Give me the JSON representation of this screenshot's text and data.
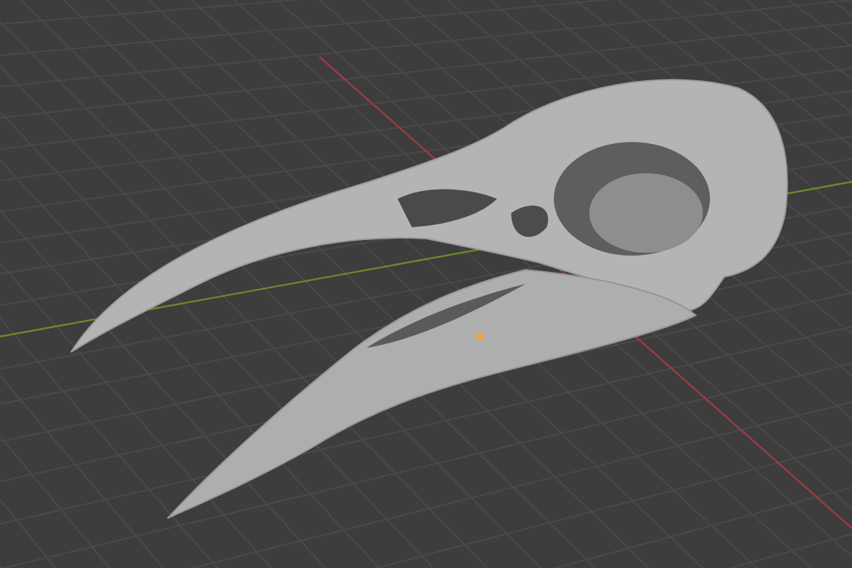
{
  "viewport": {
    "grid": true,
    "axes": true,
    "origin": true
  }
}
